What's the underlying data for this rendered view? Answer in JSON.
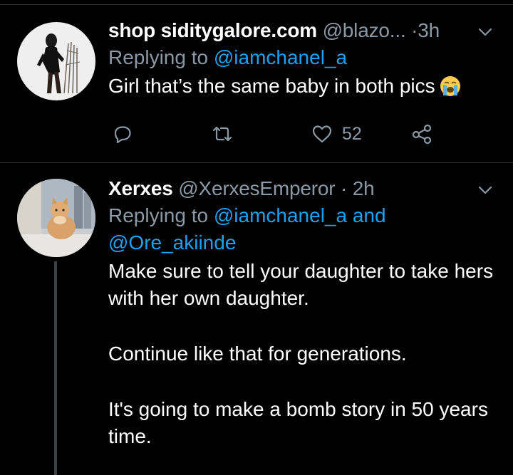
{
  "tweets": [
    {
      "display_name": "shop siditygalore.com",
      "handle": "@blazo...",
      "separator": "·",
      "time": "3h",
      "replying_prefix": "Replying to",
      "replying_mentions": [
        "@iamchanel_a"
      ],
      "text": "Girl that’s the same baby in both pics",
      "emoji": "loudly-crying-face",
      "likes": "52",
      "icons": [
        "reply-icon",
        "retweet-icon",
        "like-icon",
        "share-icon"
      ]
    },
    {
      "display_name": "Xerxes",
      "handle": "@XerxesEmperor",
      "separator": "·",
      "time": "2h",
      "replying_prefix": "Replying to",
      "replying_mentions": [
        "@iamchanel_a",
        "@Ore_akiinde"
      ],
      "replying_joiner": "and",
      "paragraphs": [
        "Make sure to tell your daughter to take hers with her own daughter.",
        "Continue like that for generations.",
        "It's going to make a bomb story in 50 years time."
      ]
    }
  ],
  "colors": {
    "background": "#000000",
    "secondary_text": "#8b98a5",
    "link": "#1da1f2",
    "divider": "#2f3336"
  }
}
